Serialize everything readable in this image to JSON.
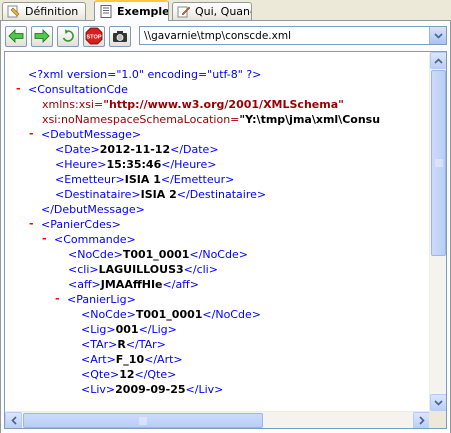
{
  "tabs": [
    {
      "label": "Définition",
      "icon": "definition-tab-icon",
      "active": false
    },
    {
      "label": "Exemple",
      "icon": "document-tab-icon",
      "active": true
    },
    {
      "label": "Qui, Quand",
      "icon": "edit-tab-icon",
      "active": false
    }
  ],
  "toolbar": {
    "back": "back-arrow-icon",
    "forward": "forward-arrow-icon",
    "refresh": "refresh-icon",
    "stop_label": "STOP",
    "print": "camera-icon"
  },
  "address": {
    "value": "\\\\gavarnie\\tmp\\conscde.xml"
  },
  "xml": {
    "decl": "<?xml version=\"1.0\" encoding=\"utf-8\" ?>",
    "root_open": "<ConsultationCde",
    "xmlns_xsi_attr": "xmlns:xsi=",
    "xmlns_xsi_val": "\"http://www.w3.org/2001/XMLSchema\"",
    "nons_attr": "xsi:noNamespaceSchemaLocation=",
    "nons_val": "\"Y:\\tmp\\jma\\xml\\Consu",
    "debut_open": "<DebutMessage>",
    "date_tag_open": "<Date>",
    "date_value": "2012-11-12",
    "date_tag_close": "</Date>",
    "heure_tag_open": "<Heure>",
    "heure_value": "15:35:46",
    "heure_tag_close": "</Heure>",
    "emetteur_tag_open": "<Emetteur>",
    "emetteur_value": "ISIA 1",
    "emetteur_tag_close": "</Emetteur>",
    "dest_tag_open": "<Destinataire>",
    "dest_value": "ISIA 2",
    "dest_tag_close": "</Destinataire>",
    "debut_close": "</DebutMessage>",
    "panier_open": "<PanierCdes>",
    "commande_open": "<Commande>",
    "nocde_tag_open": "<NoCde>",
    "nocde_value": "T001_0001",
    "nocde_tag_close": "</NoCde>",
    "cli_tag_open": "<cli>",
    "cli_value": "LAGUILLOUS3",
    "cli_tag_close": "</cli>",
    "aff_tag_open": "<aff>",
    "aff_value": "JMAAffHIe",
    "aff_tag_close": "</aff>",
    "panierlig_open": "<PanierLig>",
    "nocde2_tag_open": "<NoCde>",
    "nocde2_value": "T001_0001",
    "nocde2_tag_close": "</NoCde>",
    "lig_tag_open": "<Lig>",
    "lig_value": "001",
    "lig_tag_close": "</Lig>",
    "tar_tag_open": "<TAr>",
    "tar_value": "R",
    "tar_tag_close": "</TAr>",
    "art_tag_open": "<Art>",
    "art_value": "F_10",
    "art_tag_close": "</Art>",
    "qte_tag_open": "<Qte>",
    "qte_value": "12",
    "qte_tag_close": "</Qte>",
    "liv_tag_open": "<Liv>",
    "liv_value": "2009-09-25",
    "liv_tag_close": "</Liv>",
    "collapse_glyph": "-"
  }
}
